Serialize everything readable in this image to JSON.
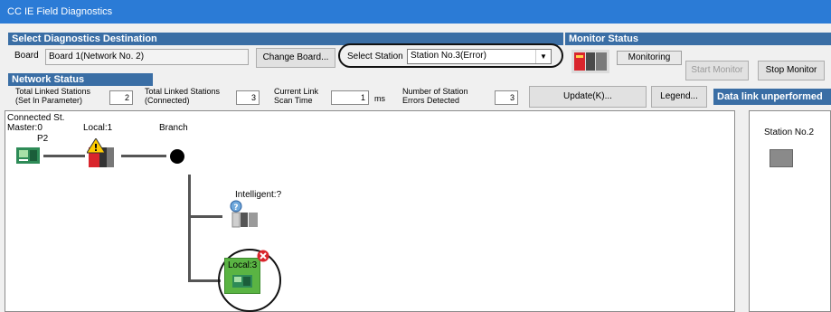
{
  "window": {
    "title": "CC IE Field Diagnostics"
  },
  "destination": {
    "header": "Select Diagnostics Destination",
    "board_label": "Board",
    "board_value": "Board 1(Network No. 2)",
    "change_board_button": "Change Board...",
    "select_station_label": "Select Station",
    "select_station_value": "Station No.3(Error)"
  },
  "monitor": {
    "header": "Monitor Status",
    "status_text": "Monitoring",
    "start_button": "Start Monitor",
    "stop_button": "Stop Monitor"
  },
  "network_status": {
    "header": "Network Status",
    "total_linked_set_label_1": "Total Linked Stations",
    "total_linked_set_label_2": "(Set In Parameter)",
    "total_linked_set_value": "2",
    "total_linked_conn_label_1": "Total Linked Stations",
    "total_linked_conn_label_2": "(Connected)",
    "total_linked_conn_value": "3",
    "scan_label_1": "Current Link",
    "scan_label_2": "Scan Time",
    "scan_value": "1",
    "scan_unit": "ms",
    "errors_label_1": "Number of Station",
    "errors_label_2": "Errors Detected",
    "errors_value": "3",
    "update_button": "Update(K)...",
    "legend_button": "Legend...",
    "data_link_header": "Data link unperformed"
  },
  "diagram": {
    "connected_label": "Connected St.",
    "master_label": "Master:0",
    "p2_label": "P2",
    "local1_label": "Local:1",
    "branch_label": "Branch",
    "intelligent_label": "Intelligent:?",
    "local3_label": "Local:3"
  },
  "right_panel": {
    "station_label": "Station No.2"
  },
  "colors": {
    "title_bar": "#2b7bd6",
    "section_header": "#3a6ea5",
    "error_red": "#d9252c",
    "green_module": "#5ab443"
  }
}
